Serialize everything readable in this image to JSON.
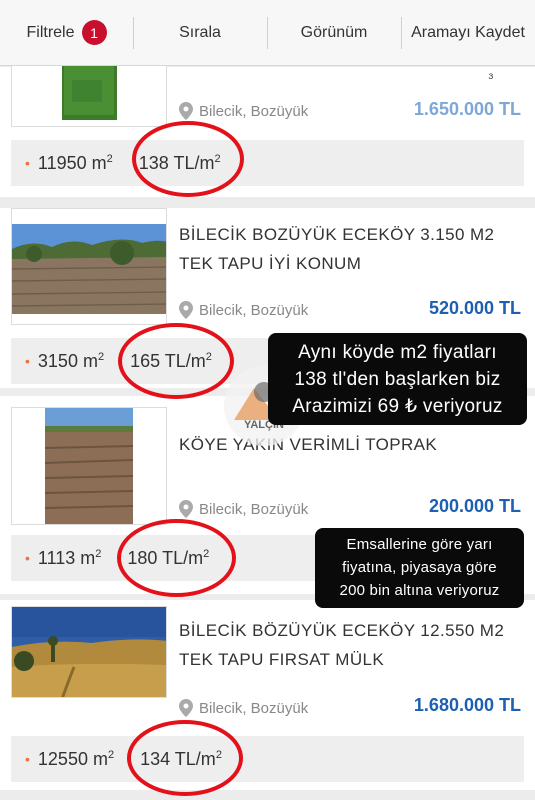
{
  "toolbar": {
    "filter_label": "Filtrele",
    "filter_count": "1",
    "sort_label": "Sırala",
    "view_label": "Görünüm",
    "save_search_label": "Aramayı Kaydet"
  },
  "listings": [
    {
      "title": "",
      "location": "Bilecik, Bozüyük",
      "price": "1.650.000 TL",
      "area": "11950 m",
      "unit_price": "138 TL/m",
      "sup": "2"
    },
    {
      "title": "BİLECİK BOZÜYÜK ECEKÖY 3.150 M2 TEK TAPU İYİ KONUM",
      "location": "Bilecik, Bozüyük",
      "price": "520.000 TL",
      "area": "3150 m",
      "unit_price": "165 TL/m",
      "sup": "2"
    },
    {
      "title": "KÖYE YAKIN VERİMLİ TOPRAK",
      "location": "Bilecik, Bozüyük",
      "price": "200.000 TL",
      "area": "1113 m",
      "unit_price": "180 TL/m",
      "sup": "2"
    },
    {
      "title": "BİLECİK BÖZÜYÜK ECEKÖY 12.550 M2 TEK TAPU FIRSAT MÜLK",
      "location": "Bilecik, Bozüyük",
      "price": "1.680.000 TL",
      "area": "12550 m",
      "unit_price": "134 TL/m",
      "sup": "2"
    }
  ],
  "notes": {
    "note1_lines": [
      "Aynı köyde m2 fiyatları",
      "138 tl'den başlarken biz",
      "Arazimizi 69 ₺ veriyoruz"
    ],
    "note2_lines": [
      "Emsallerine göre yarı",
      "fiyatına, piyasaya göre",
      "200 bin altına veriyoruz"
    ]
  },
  "watermark_text": "YALÇIN",
  "colors": {
    "price_primary": "#1d5fb1",
    "price_faded": "#7ea7d8",
    "badge": "#c8102e",
    "circle": "#e3121a",
    "dot": "#e8743b"
  }
}
